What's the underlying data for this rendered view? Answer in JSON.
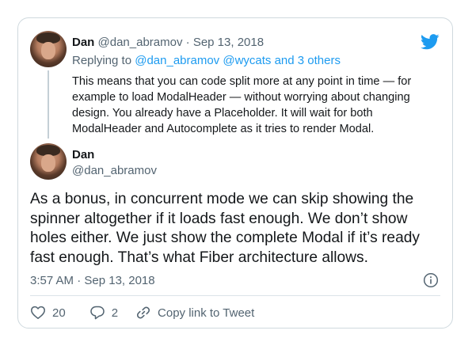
{
  "reply_tweet": {
    "author_name": "Dan",
    "author_handle": "@dan_abramov",
    "separator": "·",
    "date": "Sep 13, 2018",
    "replying_prefix": "Replying to",
    "replying_users": "@dan_abramov @wycats",
    "replying_suffix": "and 3 others",
    "text": "This means that you can code split more at any point in time — for example to load ModalHeader — without worrying about changing design. You already have a Placeholder. It will wait for both ModalHeader and Autocomplete as it tries to render Modal."
  },
  "main_tweet": {
    "author_name": "Dan",
    "author_handle": "@dan_abramov",
    "text": "As a bonus, in concurrent mode we can skip showing the spinner altogether if it loads fast enough. We don’t show holes either. We just show the complete Modal if it’s ready fast enough. That’s what Fiber architecture allows.",
    "timestamp": "3:57 AM · Sep 13, 2018"
  },
  "actions": {
    "like_count": "20",
    "reply_count": "2",
    "copy_link_label": "Copy link to Tweet"
  },
  "icons": {
    "brand": "twitter-bird-icon",
    "info": "info-icon",
    "like": "heart-icon",
    "reply": "comment-bubble-icon",
    "copy": "link-icon"
  },
  "colors": {
    "accent": "#1d9bf0",
    "muted": "#536471",
    "text": "#14171a",
    "border": "#cfd9de"
  }
}
